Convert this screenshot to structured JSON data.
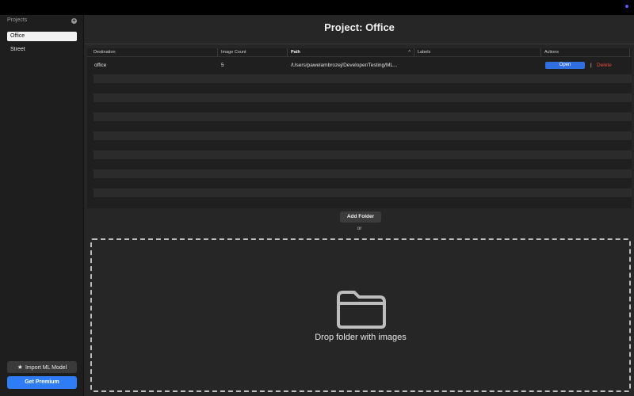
{
  "sidebar": {
    "header": "Projects",
    "add_icon": "plus-circle-icon",
    "projects": [
      {
        "label": "Office",
        "selected": true
      },
      {
        "label": "Street",
        "selected": false
      }
    ],
    "import_button": {
      "label": "Import ML Model",
      "icon": "star-icon"
    },
    "premium_button": {
      "label": "Get Premium"
    }
  },
  "main": {
    "title": "Project: Office",
    "table": {
      "columns": [
        "Destination",
        "Image Count",
        "Path",
        "Labels",
        "Actions"
      ],
      "rows": [
        {
          "destination": "office",
          "image_count": "5",
          "path": "/Users/pawelambrozej/Developer/Testing/ML...",
          "labels": "",
          "open_label": "Open",
          "separator": "|",
          "delete_label": "Delete"
        }
      ]
    },
    "add_folder_label": "Add Folder",
    "or_label": "or",
    "dropzone": {
      "icon": "folder-icon",
      "label": "Drop folder with images"
    }
  },
  "colors": {
    "accent": "#2e7cf6",
    "danger": "#e64a3b",
    "background": "#262626",
    "sidebar": "#1e1e1e"
  }
}
